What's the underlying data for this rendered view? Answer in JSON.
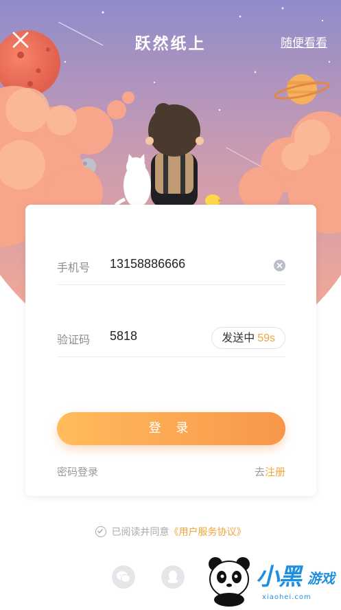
{
  "header": {
    "title": "跃然纸上",
    "browse_label": "随便看看",
    "close_icon": "close-icon"
  },
  "form": {
    "phone_label": "手机号",
    "phone_value": "13158886666",
    "code_label": "验证码",
    "code_value": "5818",
    "send_label": "发送中",
    "send_countdown": "59s",
    "login_label": "登 录",
    "password_login": "密码登录",
    "register_prefix": "去",
    "register_link": "注册"
  },
  "agreement": {
    "text": "已阅读并同意",
    "link": "《用户服务协议》"
  },
  "social": [
    "wechat-icon",
    "qq-icon"
  ],
  "watermark": {
    "brand": "小黑",
    "brand2": "游戏",
    "domain": "xiaohei.com"
  },
  "colors": {
    "accent": "#f0a53a",
    "button_start": "#ffbc5c",
    "button_end": "#f7964a",
    "sky_top": "#8f8ccb",
    "sky_bottom": "#f2a593"
  }
}
